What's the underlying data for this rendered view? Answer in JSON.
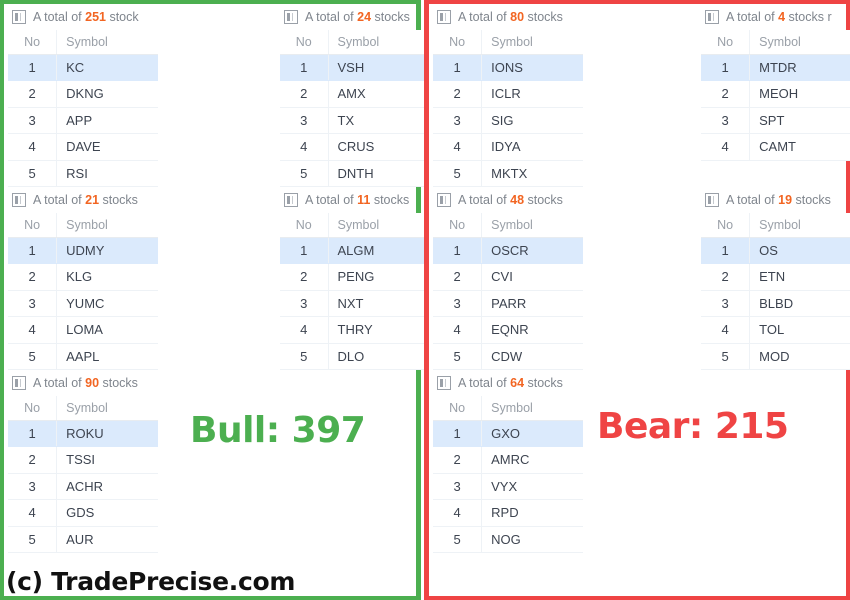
{
  "colors": {
    "bull": "#4caf50",
    "bear": "#ef4444",
    "count_highlight": "#f26522",
    "row_selected": "#dbeafc"
  },
  "table_columns": {
    "no": "No",
    "symbol": "Symbol"
  },
  "bull_panel": {
    "score_label": "Bull: 397",
    "columns": [
      {
        "blocks": [
          {
            "header_prefix": "A total of",
            "count": "251",
            "header_suffix": "stock",
            "rows": [
              {
                "no": "1",
                "symbol": "KC",
                "selected": true
              },
              {
                "no": "2",
                "symbol": "DKNG",
                "selected": false
              },
              {
                "no": "3",
                "symbol": "APP",
                "selected": false
              },
              {
                "no": "4",
                "symbol": "DAVE",
                "selected": false
              },
              {
                "no": "5",
                "symbol": "RSI",
                "selected": false
              }
            ]
          },
          {
            "header_prefix": "A total of",
            "count": "21",
            "header_suffix": "stocks",
            "rows": [
              {
                "no": "1",
                "symbol": "UDMY",
                "selected": true
              },
              {
                "no": "2",
                "symbol": "KLG",
                "selected": false
              },
              {
                "no": "3",
                "symbol": "YUMC",
                "selected": false
              },
              {
                "no": "4",
                "symbol": "LOMA",
                "selected": false
              },
              {
                "no": "5",
                "symbol": "AAPL",
                "selected": false
              }
            ]
          },
          {
            "header_prefix": "A total of",
            "count": "90",
            "header_suffix": "stocks",
            "rows": [
              {
                "no": "1",
                "symbol": "ROKU",
                "selected": true
              },
              {
                "no": "2",
                "symbol": "TSSI",
                "selected": false
              },
              {
                "no": "3",
                "symbol": "ACHR",
                "selected": false
              },
              {
                "no": "4",
                "symbol": "GDS",
                "selected": false
              },
              {
                "no": "5",
                "symbol": "AUR",
                "selected": false
              }
            ]
          }
        ]
      },
      {
        "blocks": [
          {
            "header_prefix": "A total of",
            "count": "24",
            "header_suffix": "stocks",
            "rows": [
              {
                "no": "1",
                "symbol": "VSH",
                "selected": true
              },
              {
                "no": "2",
                "symbol": "AMX",
                "selected": false
              },
              {
                "no": "3",
                "symbol": "TX",
                "selected": false
              },
              {
                "no": "4",
                "symbol": "CRUS",
                "selected": false
              },
              {
                "no": "5",
                "symbol": "DNTH",
                "selected": false
              }
            ]
          },
          {
            "header_prefix": "A total of",
            "count": "11",
            "header_suffix": "stocks",
            "rows": [
              {
                "no": "1",
                "symbol": "ALGM",
                "selected": true
              },
              {
                "no": "2",
                "symbol": "PENG",
                "selected": false
              },
              {
                "no": "3",
                "symbol": "NXT",
                "selected": false
              },
              {
                "no": "4",
                "symbol": "THRY",
                "selected": false
              },
              {
                "no": "5",
                "symbol": "DLO",
                "selected": false
              }
            ]
          }
        ]
      }
    ]
  },
  "bear_panel": {
    "score_label": "Bear: 215",
    "columns": [
      {
        "blocks": [
          {
            "header_prefix": "A total of",
            "count": "80",
            "header_suffix": "stocks",
            "rows": [
              {
                "no": "1",
                "symbol": "IONS",
                "selected": true
              },
              {
                "no": "2",
                "symbol": "ICLR",
                "selected": false
              },
              {
                "no": "3",
                "symbol": "SIG",
                "selected": false
              },
              {
                "no": "4",
                "symbol": "IDYA",
                "selected": false
              },
              {
                "no": "5",
                "symbol": "MKTX",
                "selected": false
              }
            ]
          },
          {
            "header_prefix": "A total of",
            "count": "48",
            "header_suffix": "stocks",
            "rows": [
              {
                "no": "1",
                "symbol": "OSCR",
                "selected": true
              },
              {
                "no": "2",
                "symbol": "CVI",
                "selected": false
              },
              {
                "no": "3",
                "symbol": "PARR",
                "selected": false
              },
              {
                "no": "4",
                "symbol": "EQNR",
                "selected": false
              },
              {
                "no": "5",
                "symbol": "CDW",
                "selected": false
              }
            ]
          },
          {
            "header_prefix": "A total of",
            "count": "64",
            "header_suffix": "stocks",
            "rows": [
              {
                "no": "1",
                "symbol": "GXO",
                "selected": true
              },
              {
                "no": "2",
                "symbol": "AMRC",
                "selected": false
              },
              {
                "no": "3",
                "symbol": "VYX",
                "selected": false
              },
              {
                "no": "4",
                "symbol": "RPD",
                "selected": false
              },
              {
                "no": "5",
                "symbol": "NOG",
                "selected": false
              }
            ]
          }
        ]
      },
      {
        "blocks": [
          {
            "header_prefix": "A total of",
            "count": "4",
            "header_suffix": "stocks r",
            "rows": [
              {
                "no": "1",
                "symbol": "MTDR",
                "selected": true
              },
              {
                "no": "2",
                "symbol": "MEOH",
                "selected": false
              },
              {
                "no": "3",
                "symbol": "SPT",
                "selected": false
              },
              {
                "no": "4",
                "symbol": "CAMT",
                "selected": false
              }
            ]
          },
          {
            "header_prefix": "A total of",
            "count": "19",
            "header_suffix": "stocks",
            "rows": [
              {
                "no": "1",
                "symbol": "OS",
                "selected": true
              },
              {
                "no": "2",
                "symbol": "ETN",
                "selected": false
              },
              {
                "no": "3",
                "symbol": "BLBD",
                "selected": false
              },
              {
                "no": "4",
                "symbol": "TOL",
                "selected": false
              },
              {
                "no": "5",
                "symbol": "MOD",
                "selected": false
              }
            ]
          }
        ]
      }
    ]
  },
  "watermark": "(c) TradePrecise.com"
}
